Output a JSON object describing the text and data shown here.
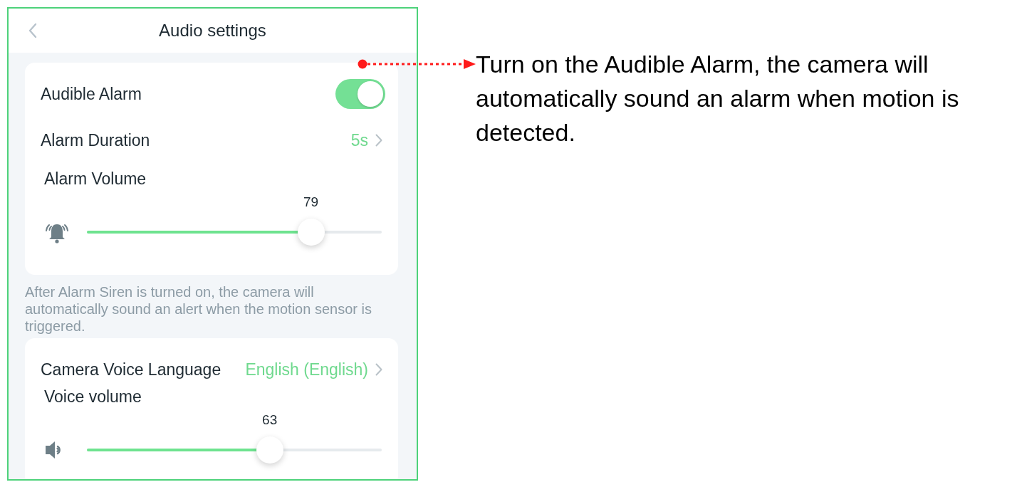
{
  "header": {
    "title": "Audio settings"
  },
  "sections": [
    {
      "kind": "card",
      "rows": [
        {
          "kind": "toggle",
          "label": "Audible Alarm",
          "on": true
        },
        {
          "kind": "choice",
          "label": "Alarm Duration",
          "value": "5s"
        },
        {
          "kind": "slider",
          "label": "Alarm Volume",
          "reading": "79",
          "level": 0.76
        }
      ]
    },
    {
      "kind": "note",
      "text": "After Alarm Siren is turned on, the camera will automatically sound an alert when the motion sensor is triggered."
    },
    {
      "kind": "card",
      "rows": [
        {
          "kind": "choice",
          "label": "Camera Voice Language",
          "value": "English (English)"
        },
        {
          "kind": "slider",
          "label": "Voice volume",
          "reading": "63",
          "level": 0.62
        }
      ]
    }
  ],
  "callout": {
    "text": "Turn on the Audible Alarm, the camera will automatically sound an alarm when motion is detected."
  }
}
